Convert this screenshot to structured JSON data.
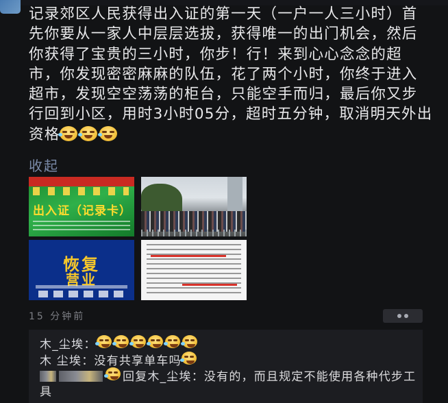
{
  "post": {
    "body": "记录郊区人民获得出入证的第一天（一户一人三小时）首先你要从一家人中层层选拔，获得唯一的出门机会，然后你获得了宝贵的三小时，你步！行！来到心心念念的超市，你发现密密麻麻的队伍，花了两个小时，你终于进入超市，发现空空荡荡的柜台，只能空手而归，最后你又步行回到小区，用时3小时05分，超时五分钟，取消明天外出资格",
    "trailing_emoji": "laugh-cry-emoji ×3",
    "collapse_label": "收起",
    "photos": [
      {
        "name": "photo-pass-card",
        "text": "出入证（记录卡）"
      },
      {
        "name": "photo-queue-crowd",
        "text": ""
      },
      {
        "name": "photo-reopen-poster",
        "text_line1": "恢复",
        "text_line2": "营业"
      },
      {
        "name": "photo-notice-document",
        "text": ""
      }
    ],
    "timestamp": "15 分钟前"
  },
  "comments": [
    {
      "user": "木_尘埃",
      "separator": "：",
      "text": "",
      "emoji_count": 6
    },
    {
      "user": "木  尘埃",
      "separator": "：",
      "text": "没有共享单车吗",
      "emoji_count": 1
    },
    {
      "user": "",
      "reply_label": "回复",
      "reply_to": "木_尘埃",
      "separator": "：",
      "text": "没有的，而且规定不能使用各种代步工具"
    }
  ],
  "colors": {
    "background": "#121315",
    "text": "#e8e8ea",
    "link": "#7a8aa8",
    "comment_bg": "#1c1d21",
    "muted": "#7d7f85"
  }
}
